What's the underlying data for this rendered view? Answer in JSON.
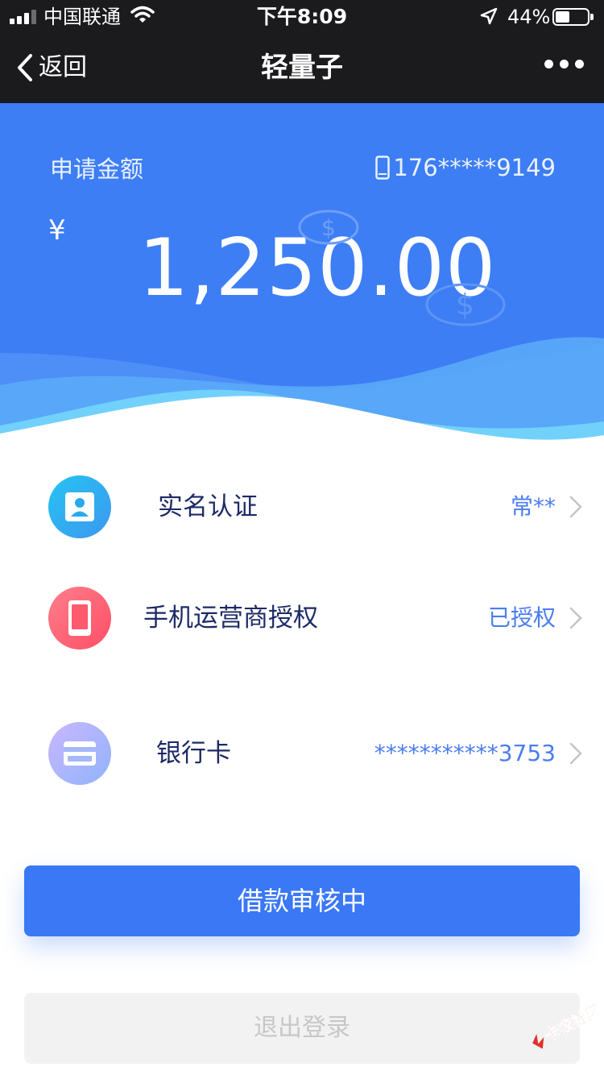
{
  "status_bar": {
    "carrier": "中国联通",
    "time": "下午8:09",
    "battery_percent": "44%",
    "battery_level": 0.44
  },
  "nav": {
    "back_label": "返回",
    "title": "轻量子"
  },
  "hero": {
    "apply_label": "申请金额",
    "phone": "176*****9149",
    "currency": "¥",
    "amount": "1,250.00",
    "coin_glyph": "$"
  },
  "list": [
    {
      "label": "实名认证",
      "value": "常**",
      "icon": "id-card-icon"
    },
    {
      "label": "手机运营商授权",
      "value": "已授权",
      "icon": "mobile-phone-icon"
    },
    {
      "label": "银行卡",
      "value": "***********3753",
      "icon": "bank-card-icon"
    }
  ],
  "buttons": {
    "primary": "借款审核中",
    "secondary": "退出登录"
  },
  "watermark": {
    "text": "卡农社区"
  },
  "colors": {
    "accent": "#3a78f5",
    "hero_blue": "#3d7ef5",
    "value_text": "#4a7df0",
    "label_text": "#1d2a66"
  }
}
